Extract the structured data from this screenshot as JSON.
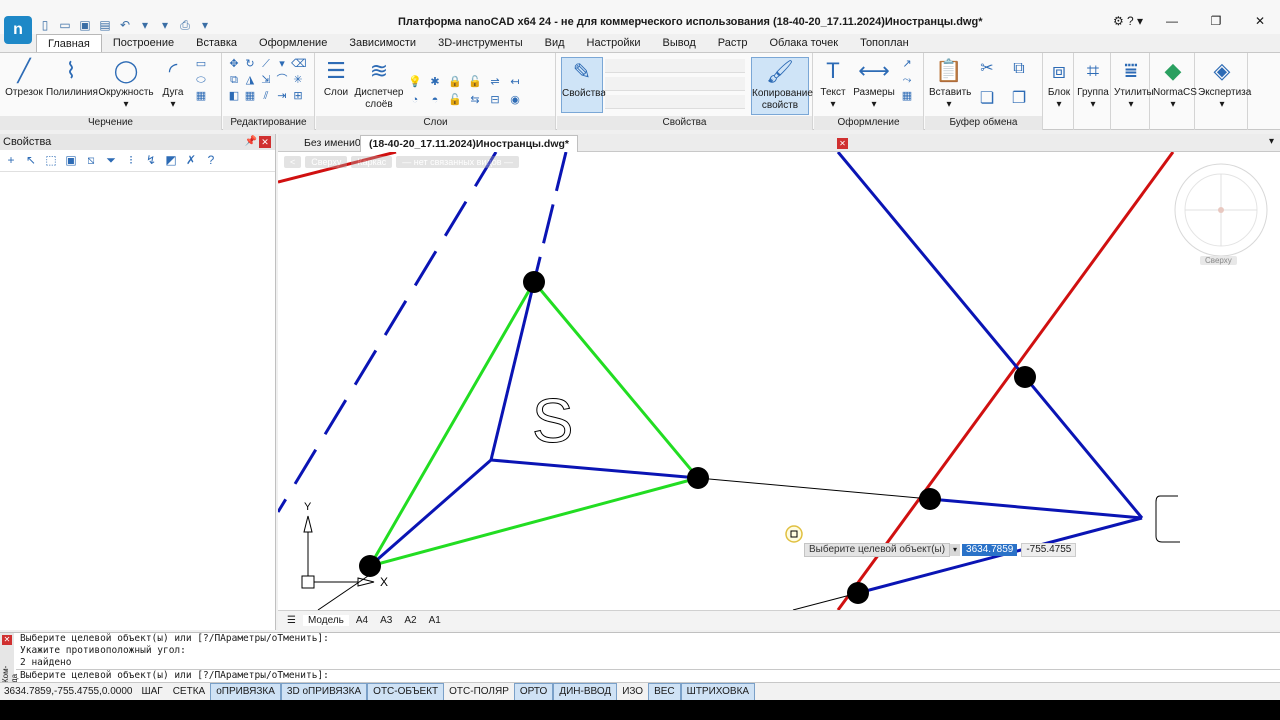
{
  "app": {
    "title": "Платформа nanoCAD x64 24 - не для коммерческого использования (18-40-20_17.11.2024)Иностранцы.dwg*",
    "logo": "n"
  },
  "ribbon_tabs": [
    "Главная",
    "Построение",
    "Вставка",
    "Оформление",
    "Зависимости",
    "3D-инструменты",
    "Вид",
    "Настройки",
    "Вывод",
    "Растр",
    "Облака точек",
    "Топоплан"
  ],
  "ribbon": {
    "drawing": {
      "label": "Черчение",
      "tools": [
        "Отрезок",
        "Полилиния",
        "Окружность",
        "Дуга"
      ]
    },
    "editing": {
      "label": "Редактирование"
    },
    "layers": {
      "label": "Слои",
      "tools": [
        "Слои",
        "Диспетчер слоёв"
      ]
    },
    "properties": {
      "label": "Свойства",
      "tool": "Свойства",
      "copy_tool": "Копирование свойств"
    },
    "annotation": {
      "label": "Оформление",
      "tools": [
        "Текст",
        "Размеры"
      ]
    },
    "clipboard": {
      "label": "Буфер обмена",
      "tool": "Вставить"
    },
    "extra": [
      "Блок",
      "Группа",
      "Утилиты",
      "NormaCS",
      "Экспертиза"
    ]
  },
  "properties_panel": {
    "title": "Свойства"
  },
  "doc_tabs": [
    "Без имени0",
    "(18-40-20_17.11.2024)Иностранцы.dwg*"
  ],
  "view_bar": [
    "<",
    "Сверху",
    "Каркас",
    "— нет связанных видов —"
  ],
  "viewcube_label": "Сверху",
  "canvas": {
    "text_label": "S",
    "axis_y": "Y",
    "axis_x": "X",
    "prompt_label": "Выберите целевой объект(ы)",
    "prompt_x": "3634.7859",
    "prompt_y": "-755.4755"
  },
  "model_tabs": [
    "Модель",
    "A4",
    "A3",
    "A2",
    "A1"
  ],
  "command": {
    "side_label": "Ком-да",
    "lines": [
      "Выберите целевой объект(ы) или [?/ПАраметры/оТменить]:",
      "Укажите противоположный угол:",
      "2 найдено"
    ],
    "input": "Выберите целевой объект(ы) или [?/ПАраметры/оТменить]:"
  },
  "status": {
    "coords": "3634.7859,-755.4755,0.0000",
    "toggles": [
      {
        "label": "ШАГ",
        "on": false
      },
      {
        "label": "СЕТКА",
        "on": false
      },
      {
        "label": "оПРИВЯЗКА",
        "on": true
      },
      {
        "label": "3D оПРИВЯЗКА",
        "on": true
      },
      {
        "label": "ОТС-ОБЪЕКТ",
        "on": true
      },
      {
        "label": "ОТС-ПОЛЯР",
        "on": false
      },
      {
        "label": "ОРТО",
        "on": true
      },
      {
        "label": "ДИН-ВВОД",
        "on": true
      },
      {
        "label": "ИЗО",
        "on": false
      },
      {
        "label": "ВЕС",
        "on": true
      },
      {
        "label": "ШТРИХОВКА",
        "on": true
      }
    ]
  },
  "colors": {
    "blue_line": "#0a14b4",
    "green_line": "#22dd22",
    "red_line": "#d01010",
    "accent": "#2a72c8"
  }
}
